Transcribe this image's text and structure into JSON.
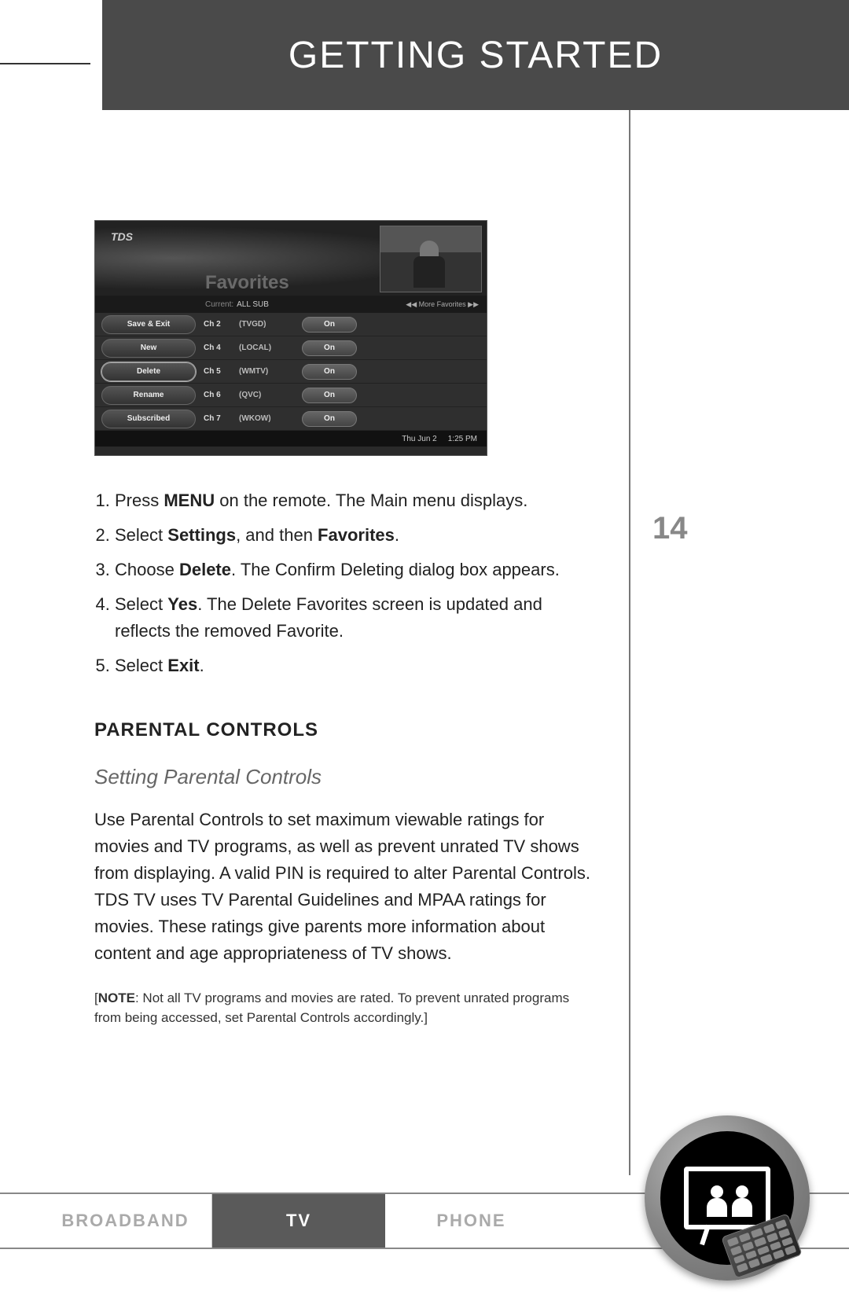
{
  "header": {
    "title": "GETTING STARTED"
  },
  "page_number": "14",
  "tv_shot": {
    "logo": "TDS",
    "title": "Favorites",
    "current_label": "Current:",
    "current_value": "ALL SUB",
    "more_label": "◀◀ More Favorites ▶▶",
    "side_buttons": [
      "Save & Exit",
      "New",
      "Delete",
      "Rename",
      "Subscribed"
    ],
    "rows": [
      {
        "ch": "Ch 2",
        "call": "(TVGD)",
        "state": "On"
      },
      {
        "ch": "Ch 4",
        "call": "(LOCAL)",
        "state": "On"
      },
      {
        "ch": "Ch 5",
        "call": "(WMTV)",
        "state": "On"
      },
      {
        "ch": "Ch 6",
        "call": "(QVC)",
        "state": "On"
      },
      {
        "ch": "Ch 7",
        "call": "(WKOW)",
        "state": "On"
      }
    ],
    "footer_date": "Thu Jun 2",
    "footer_time": "1:25 PM"
  },
  "steps": {
    "s1_pre": "Press ",
    "s1_b1": "MENU",
    "s1_post": " on the remote. The Main menu displays.",
    "s2_pre": "Select ",
    "s2_b1": "Settings",
    "s2_mid": ", and then ",
    "s2_b2": "Favorites",
    "s2_post": ".",
    "s3_pre": "Choose ",
    "s3_b1": "Delete",
    "s3_post": ". The Confirm Deleting dialog box appears.",
    "s4_pre": "Select ",
    "s4_b1": "Yes",
    "s4_post": ". The Delete Favorites screen is updated and reflects the removed Favorite.",
    "s5_pre": "Select ",
    "s5_b1": "Exit",
    "s5_post": "."
  },
  "section_title": "PARENTAL CONTROLS",
  "sub_title": "Setting Parental Controls",
  "paragraph": "Use Parental Controls to set maximum viewable ratings for movies and TV programs, as well as prevent unrated TV shows from displaying. A valid PIN is required to alter Parental Controls. TDS TV uses TV Parental Guidelines and MPAA ratings for movies. These ratings give parents more information about content and age appropriateness of TV shows.",
  "note_open": "[",
  "note_bold": "NOTE",
  "note_body": ": Not all TV programs and movies are rated. To prevent unrated programs from being accessed, set Parental Controls accordingly.]",
  "tabs": {
    "broadband": "BROADBAND",
    "tv": "TV",
    "phone": "PHONE"
  }
}
